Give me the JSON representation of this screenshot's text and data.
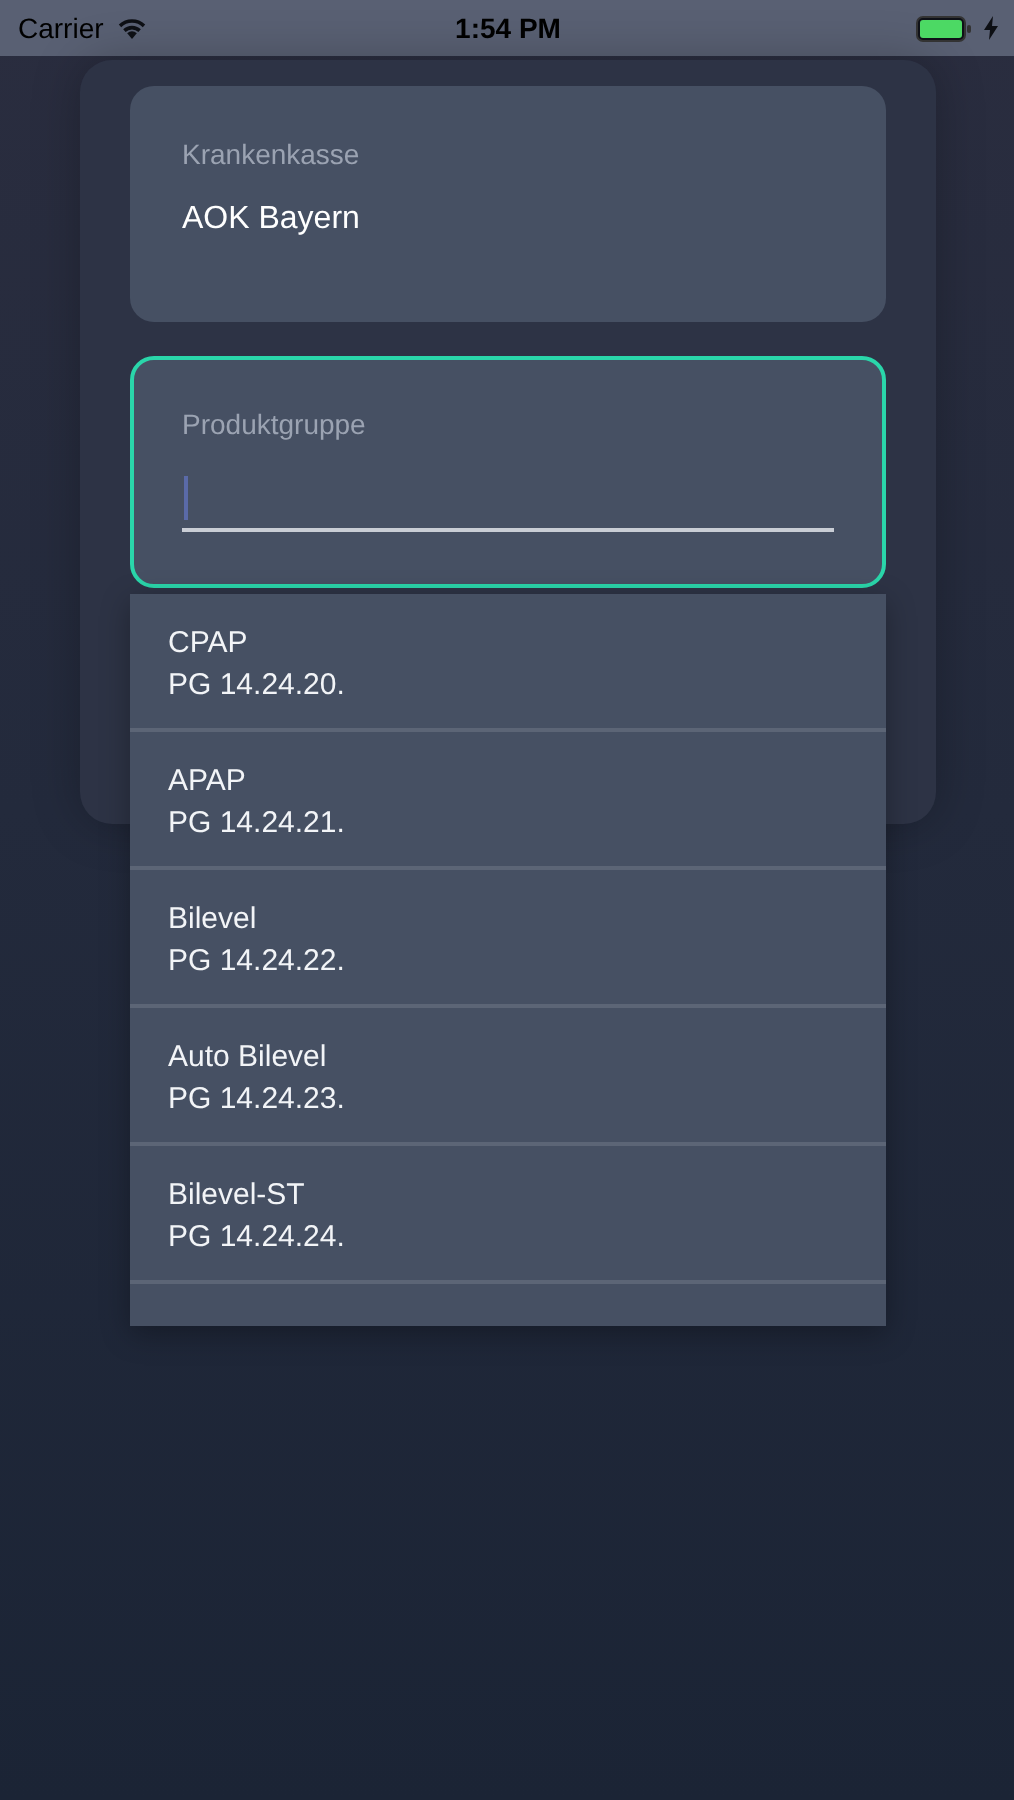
{
  "status_bar": {
    "carrier": "Carrier",
    "time": "1:54 PM",
    "charging": true
  },
  "fields": [
    {
      "label": "Krankenkasse",
      "value": "AOK Bayern",
      "focused": false
    },
    {
      "label": "Produktgruppe",
      "focused": true
    }
  ],
  "dropdown": {
    "options": [
      {
        "name": "CPAP",
        "code": "PG 14.24.20."
      },
      {
        "name": "APAP",
        "code": "PG 14.24.21."
      },
      {
        "name": "Bilevel",
        "code": "PG 14.24.22."
      },
      {
        "name": "Auto Bilevel",
        "code": "PG 14.24.23."
      },
      {
        "name": "Bilevel-ST",
        "code": "PG 14.24.24."
      }
    ]
  }
}
